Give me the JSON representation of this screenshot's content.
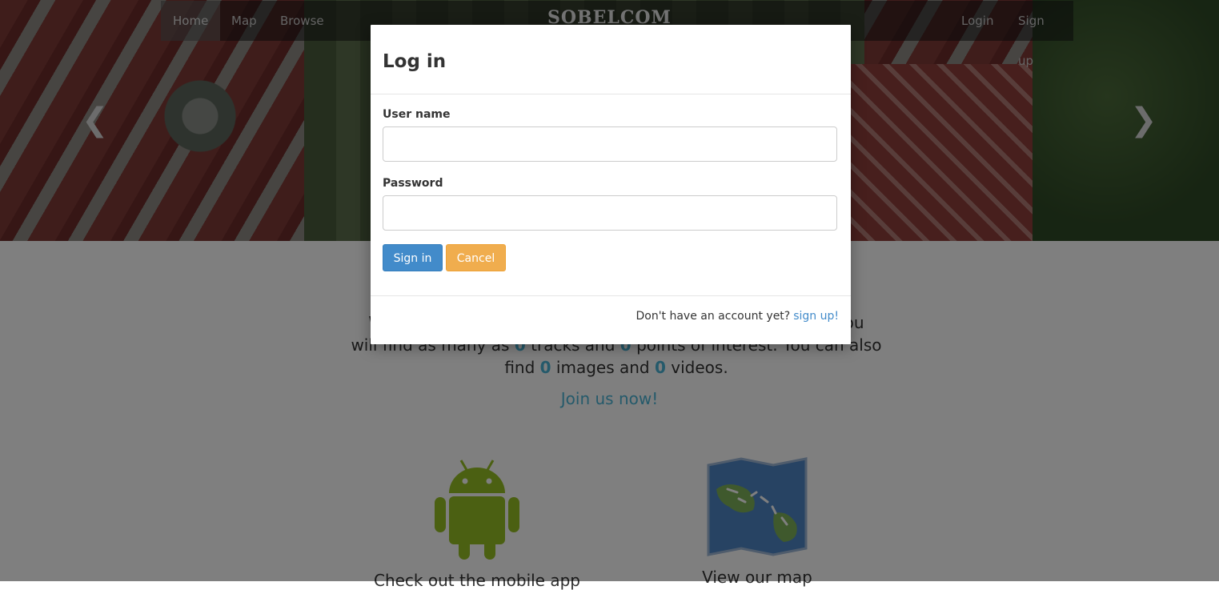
{
  "nav": {
    "home": "Home",
    "map": "Map",
    "browse": "Browse",
    "brand": "SOBELCOM",
    "login": "Login",
    "signup": "Sign up"
  },
  "carousel": {
    "prev_icon": "chevron-left-icon",
    "next_icon": "chevron-right-icon"
  },
  "intro": {
    "first": "We",
    "line_end": "e you",
    "part1": "will find as many as",
    "tracks_count": "0",
    "part2": "tracks and",
    "poi_count": "0",
    "part3": "points of interest. You can also find",
    "images_count": "0",
    "part4": "images and",
    "videos_count": "0",
    "part5": "videos."
  },
  "join_link": "Join us now!",
  "features": {
    "android_label": "Check out the mobile app",
    "map_label": "View our map"
  },
  "modal": {
    "title": "Log in",
    "username_label": "User name",
    "username_value": "",
    "password_label": "Password",
    "password_value": "",
    "signin_button": "Sign in",
    "cancel_button": "Cancel",
    "footer_text": "Don't have an account yet?",
    "footer_link": "sign up!"
  },
  "colors": {
    "primary": "#428bca",
    "warning": "#f0ad4e",
    "accent": "#4bb5d6"
  }
}
